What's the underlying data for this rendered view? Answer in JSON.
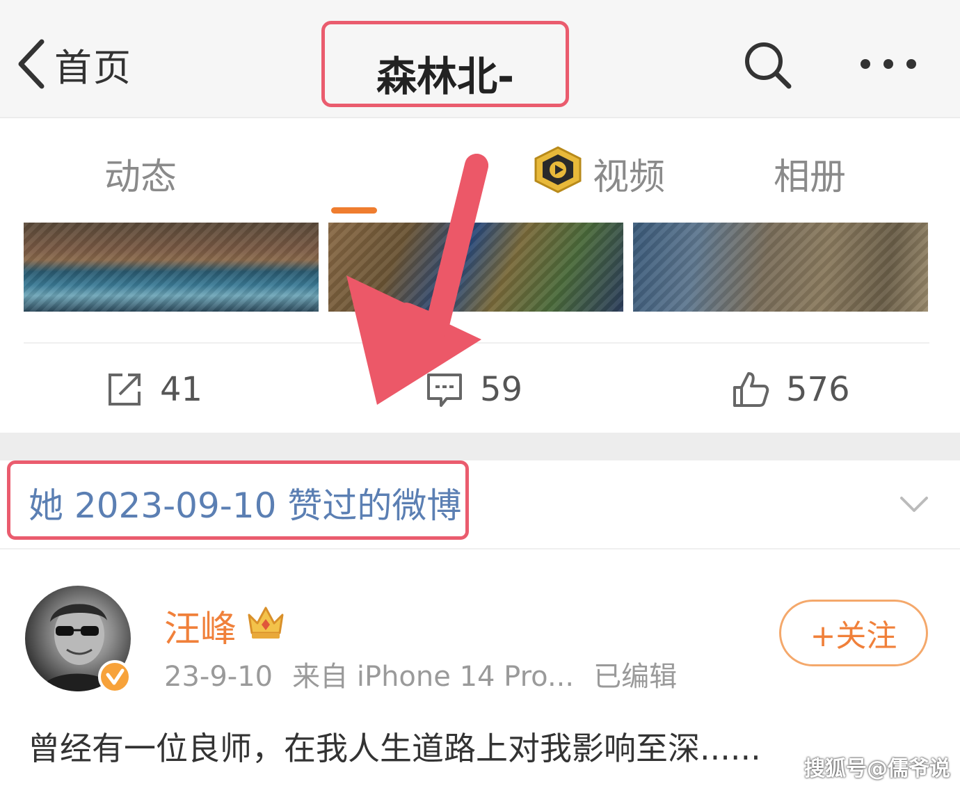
{
  "nav": {
    "back_label": "首页",
    "title": "森林北-"
  },
  "tabs": [
    {
      "label": "动态"
    },
    {
      "label": "视频"
    },
    {
      "label": "相册"
    }
  ],
  "actions": {
    "repost_count": "41",
    "comment_count": "59",
    "like_count": "576"
  },
  "liked_section": {
    "text": "她 2023-09-10 赞过的微博"
  },
  "post": {
    "username": "汪峰",
    "date": "23-9-10",
    "source": "来自 iPhone 14 Pro...",
    "edited": "已编辑",
    "follow_label": "+关注",
    "text": "曾经有一位良师，在我人生道路上对我影响至深......"
  },
  "watermark": "搜狐号@儒爷说",
  "colors": {
    "accent_orange": "#f0803a",
    "highlight_red": "#ea5c6e",
    "link_blue": "#5b7fb3"
  },
  "icons": [
    "chevron-left-icon",
    "search-icon",
    "more-icon",
    "video-badge-icon",
    "repost-icon",
    "comment-icon",
    "like-icon",
    "chevron-down-icon",
    "verified-icon",
    "crown-icon",
    "red-arrow"
  ]
}
